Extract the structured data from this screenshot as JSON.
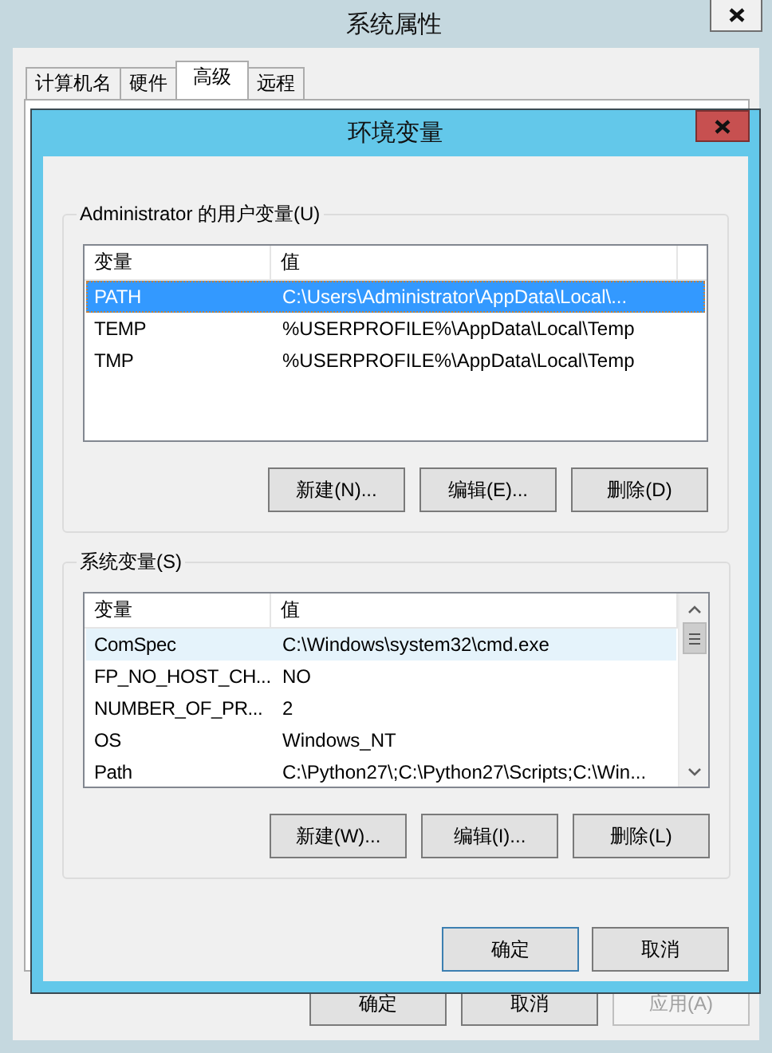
{
  "window": {
    "title": "系统属性"
  },
  "tabs": [
    {
      "label": "计算机名",
      "selected": false
    },
    {
      "label": "硬件",
      "selected": false
    },
    {
      "label": "高级",
      "selected": true
    },
    {
      "label": "远程",
      "selected": false
    }
  ],
  "buttons": [
    {
      "label": "确定",
      "disabled": false
    },
    {
      "label": "取消",
      "disabled": false
    },
    {
      "label": "应用(A)",
      "disabled": true
    }
  ],
  "dialog": {
    "title": "环境变量",
    "user_variables": {
      "title": "Administrator 的用户变量(U)",
      "columns": [
        "变量",
        "值"
      ],
      "rows": [
        {
          "name": "PATH",
          "value": "C:\\Users\\Administrator\\AppData\\Local\\...",
          "selected": true
        },
        {
          "name": "TEMP",
          "value": "%USERPROFILE%\\AppData\\Local\\Temp",
          "selected": false
        },
        {
          "name": "TMP",
          "value": "%USERPROFILE%\\AppData\\Local\\Temp",
          "selected": false
        }
      ],
      "buttons": [
        "新建(N)...",
        "编辑(E)...",
        "删除(D)"
      ]
    },
    "system_variables": {
      "title": "系统变量(S)",
      "columns": [
        "变量",
        "值"
      ],
      "rows": [
        {
          "name": "ComSpec",
          "value": "C:\\Windows\\system32\\cmd.exe",
          "hovered": true
        },
        {
          "name": "FP_NO_HOST_CH...",
          "value": "NO",
          "hovered": false
        },
        {
          "name": "NUMBER_OF_PR...",
          "value": "2",
          "hovered": false
        },
        {
          "name": "OS",
          "value": "Windows_NT",
          "hovered": false
        },
        {
          "name": "Path",
          "value": "C:\\Python27\\;C:\\Python27\\Scripts;C:\\Win...",
          "hovered": false
        }
      ],
      "buttons": [
        "新建(W)...",
        "编辑(I)...",
        "删除(L)"
      ]
    },
    "buttons": [
      {
        "label": "确定",
        "default": true
      },
      {
        "label": "取消",
        "default": false
      }
    ]
  }
}
